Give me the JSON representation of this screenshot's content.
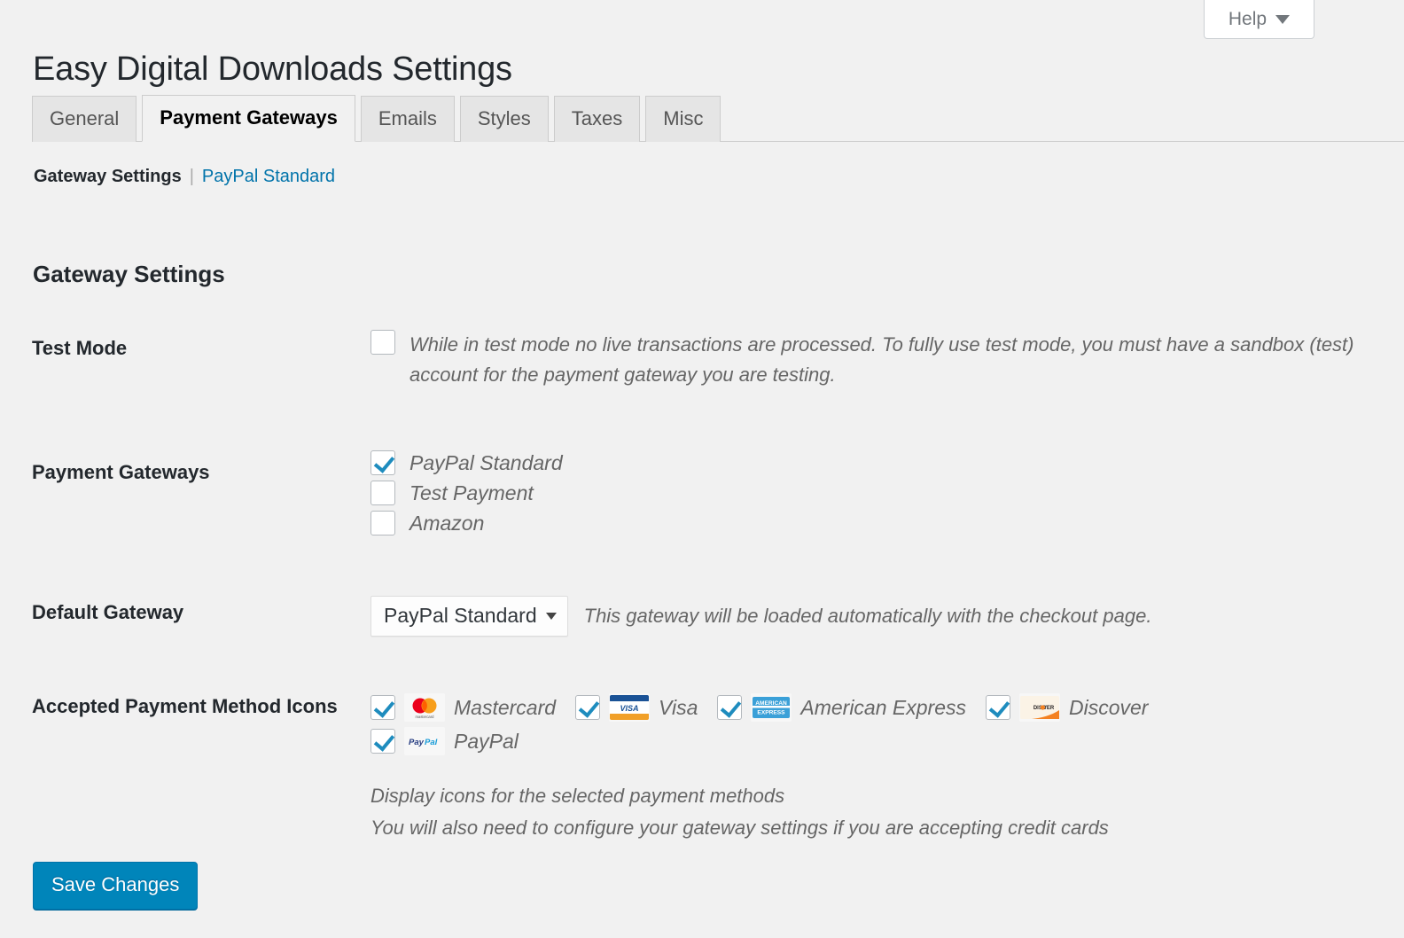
{
  "help": {
    "label": "Help",
    "icon": "chevron-down-icon"
  },
  "header": {
    "title": "Easy Digital Downloads Settings"
  },
  "tabs": [
    {
      "label": "General",
      "active": false
    },
    {
      "label": "Payment Gateways",
      "active": true
    },
    {
      "label": "Emails",
      "active": false
    },
    {
      "label": "Styles",
      "active": false
    },
    {
      "label": "Taxes",
      "active": false
    },
    {
      "label": "Misc",
      "active": false
    }
  ],
  "subnav": {
    "current": "Gateway Settings",
    "separator": "|",
    "link": "PayPal Standard"
  },
  "section": {
    "heading": "Gateway Settings"
  },
  "test_mode": {
    "label": "Test Mode",
    "checked": false,
    "description": "While in test mode no live transactions are processed. To fully use test mode, you must have a sandbox (test) account for the payment gateway you are testing."
  },
  "payment_gateways": {
    "label": "Payment Gateways",
    "items": [
      {
        "label": "PayPal Standard",
        "checked": true
      },
      {
        "label": "Test Payment",
        "checked": false
      },
      {
        "label": "Amazon",
        "checked": false
      }
    ]
  },
  "default_gateway": {
    "label": "Default Gateway",
    "value": "PayPal Standard",
    "options": [
      "PayPal Standard",
      "Test Payment",
      "Amazon"
    ],
    "description": "This gateway will be loaded automatically with the checkout page."
  },
  "payment_icons": {
    "label": "Accepted Payment Method Icons",
    "items": [
      {
        "label": "Mastercard",
        "checked": true,
        "icon": "mastercard-icon"
      },
      {
        "label": "Visa",
        "checked": true,
        "icon": "visa-icon"
      },
      {
        "label": "American Express",
        "checked": true,
        "icon": "amex-icon"
      },
      {
        "label": "Discover",
        "checked": true,
        "icon": "discover-icon"
      },
      {
        "label": "PayPal",
        "checked": true,
        "icon": "paypal-icon"
      }
    ],
    "description_lines": [
      "Display icons for the selected payment methods",
      "You will also need to configure your gateway settings if you are accepting credit cards"
    ]
  },
  "save": {
    "label": "Save Changes"
  },
  "colors": {
    "accent": "#0073aa",
    "button": "#0085ba",
    "background": "#f1f1f1",
    "checkbox_check": "#1e8cbe"
  }
}
